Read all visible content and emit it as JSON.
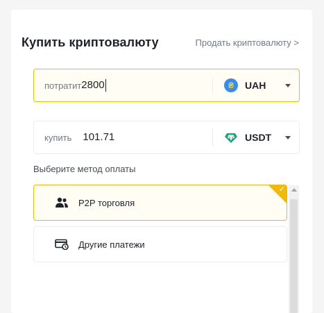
{
  "header": {
    "title": "Купить криптовалюту",
    "sell_link": "Продать криптовалюту >"
  },
  "spend": {
    "label": "потратит",
    "value": "2800",
    "currency": {
      "code": "UAH",
      "icon": "hryvnia-icon",
      "symbol": "₴",
      "color": "#3b8bea"
    }
  },
  "buy": {
    "label": "купить",
    "value": "101.71",
    "currency": {
      "code": "USDT",
      "icon": "tether-icon",
      "color": "#26a17b"
    }
  },
  "payment": {
    "label": "Выберите метод оплаты",
    "methods": [
      {
        "label": "P2P торговля",
        "icon": "users-icon",
        "selected": true
      },
      {
        "label": "Другие платежи",
        "icon": "card-payment-icon",
        "selected": false
      }
    ]
  },
  "colors": {
    "accent": "#f0b90b",
    "text": "#1e2329",
    "muted": "#707a8a"
  }
}
